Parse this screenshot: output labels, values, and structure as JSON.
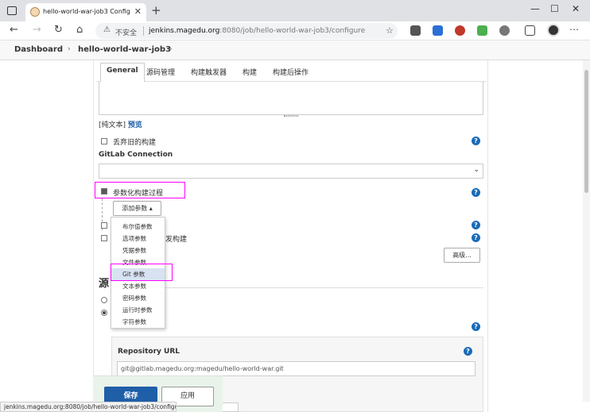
{
  "browser": {
    "tab_title": "hello-world-war-job3 Config [Jenkins]",
    "new_tab_symbol": "+",
    "close_symbol": "✕",
    "window_controls": [
      "—",
      "☐",
      "✕"
    ],
    "address": {
      "security_label": "不安全",
      "host": "jenkins.magedu.org",
      "rest": ":8080/job/hello-world-war-job3/configure"
    }
  },
  "breadcrumb": {
    "items": [
      "Dashboard",
      "hello-world-war-job3"
    ],
    "arrow": "›"
  },
  "config_tabs": [
    "General",
    "源码管理",
    "构建触发器",
    "构建",
    "构建后操作"
  ],
  "description": {
    "plain_text": "[纯文本]",
    "preview": "预览"
  },
  "options": {
    "discard_old_builds": "丢弃旧的构建",
    "gitlab_connection_label": "GitLab Connection",
    "parameterized": "参数化构建过程",
    "add_param_button": "添加参数",
    "hidden_option_suffix": "发构建",
    "advanced_button": "高级..."
  },
  "param_menu": [
    "布尔值参数",
    "选项参数",
    "凭据参数",
    "文件参数",
    "Git 参数",
    "文本参数",
    "密码参数",
    "运行时参数",
    "字符参数"
  ],
  "scm": {
    "section_title_fragment": "源",
    "repository_url_label": "Repository URL",
    "repository_url_value": "git@gitlab.magedu.org:magedu/hello-world-war.git"
  },
  "buttons": {
    "save": "保存",
    "apply": "应用"
  },
  "status_bar": "jenkins.magedu.org:8080/job/hello-world-war-job3/configure#",
  "help_glyph": "?",
  "colors": {
    "accent": "#1f5fa8",
    "highlight": "#ff00ff",
    "menu_active": "#d8e2f3"
  }
}
